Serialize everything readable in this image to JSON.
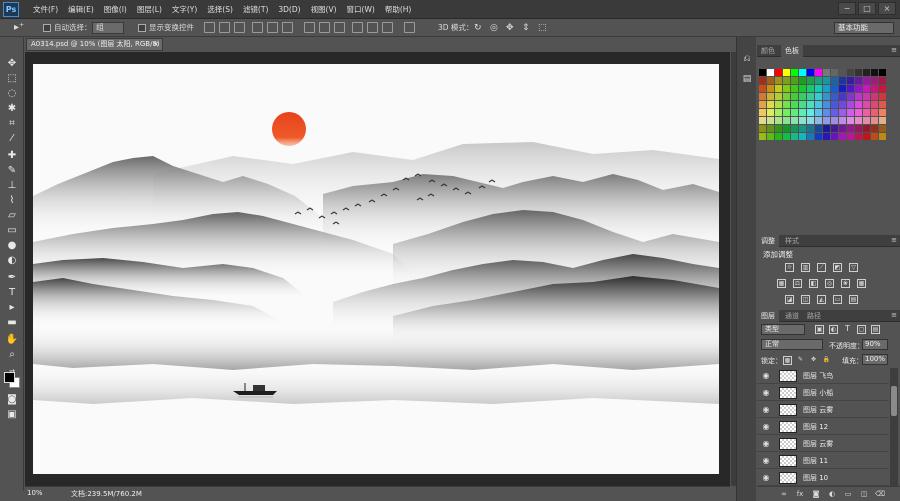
{
  "app": {
    "logo": "Ps"
  },
  "menu": [
    "文件(F)",
    "编辑(E)",
    "图像(I)",
    "图层(L)",
    "文字(Y)",
    "选择(S)",
    "滤镜(T)",
    "3D(D)",
    "视图(V)",
    "窗口(W)",
    "帮助(H)"
  ],
  "window_controls": {
    "minimize": "−",
    "maximize": "□",
    "close": "×"
  },
  "options_bar": {
    "auto_select_label": "自动选择：",
    "auto_select_value": "组",
    "show_transform_label": "显示变换控件",
    "mode_3d_label": "3D 模式：",
    "workspace": "基本功能"
  },
  "document": {
    "tab_title": "A0314.psd @ 10% (图层 太阳, RGB/8)",
    "tab_close": "×"
  },
  "status": {
    "zoom": "10%",
    "doc_size": "文档:239.5M/760.2M"
  },
  "panels": {
    "color_tabs": [
      "颜色",
      "色板"
    ],
    "adjust_tabs": [
      "调整",
      "样式"
    ],
    "adjust_title": "添加调整",
    "layers_tabs": [
      "图层",
      "通道",
      "路径"
    ],
    "layers_filter": "类型",
    "blend_mode": "正常",
    "opacity_label": "不透明度：",
    "opacity_value": "90%",
    "lock_label": "锁定：",
    "fill_label": "填充：",
    "fill_value": "100%"
  },
  "layers": [
    {
      "name": "图层 飞鸟"
    },
    {
      "name": "图层 小船"
    },
    {
      "name": "图层 云雾"
    },
    {
      "name": "图层 12"
    },
    {
      "name": "图层 云雾"
    },
    {
      "name": "图层 11"
    },
    {
      "name": "图层 10"
    }
  ],
  "colors": {
    "sun": "#e8421a",
    "chrome_dark": "#3a3a3a",
    "panel": "#535353",
    "pasteboard": "#282828"
  }
}
